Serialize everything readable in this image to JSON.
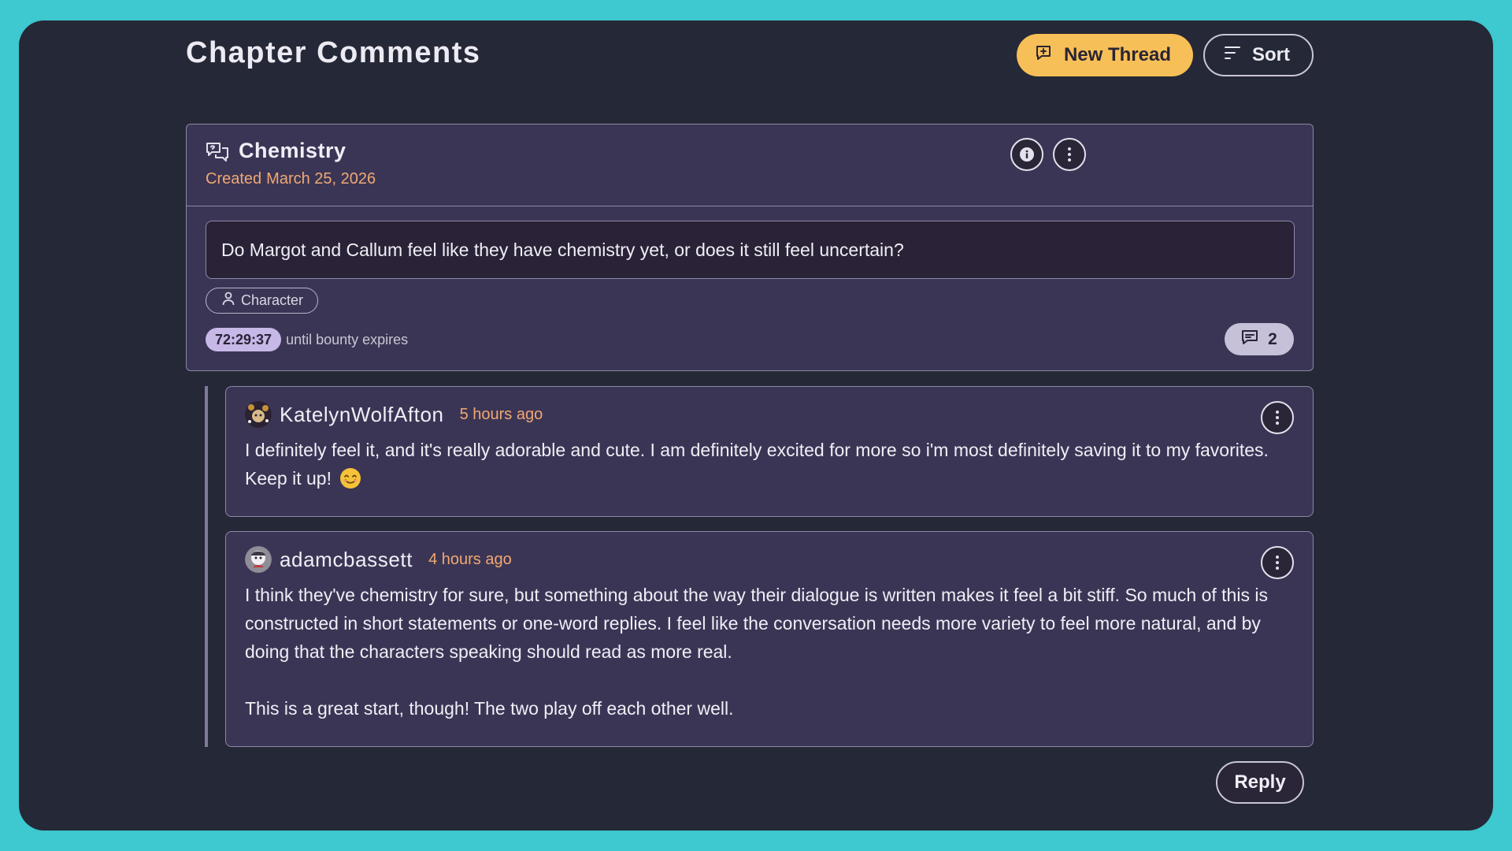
{
  "page": {
    "title": "Chapter Comments"
  },
  "toolbar": {
    "new_thread_label": "New Thread",
    "sort_label": "Sort"
  },
  "thread": {
    "name": "Chemistry",
    "created_prefix": "Created",
    "created_date": "March 25, 2026",
    "question": "Do Margot and Callum feel like they have chemistry yet, or does it still feel uncertain?",
    "tag": "Character",
    "timer": "72:29:37",
    "timer_suffix": "until bounty expires",
    "comment_count": "2"
  },
  "comments": [
    {
      "username": "KatelynWolfAfton",
      "time_ago": "5 hours ago",
      "paragraphs": [
        "I definitely feel it, and it's really adorable and cute. I am definitely excited for more so i'm most definitely saving it to my favorites. Keep it up!"
      ],
      "emoji": "smiling-face-emoji"
    },
    {
      "username": "adamcbassett",
      "time_ago": "4 hours ago",
      "paragraphs": [
        "I think they've chemistry for sure, but something about the way their dialogue is written makes it feel a bit stiff. So much of this is constructed in short statements or one-word replies. I feel like the conversation needs more variety to feel more natural, and by doing that the characters speaking should read as more real.",
        "This is a great start, though! The two play off each other well."
      ]
    }
  ],
  "reply_label": "Reply",
  "colors": {
    "background": "#3ec8cf",
    "panel": "#252836",
    "card": "#3b3555",
    "accent": "#f7bf57",
    "timestamp": "#f0a872",
    "timer_badge": "#c7b8e8"
  }
}
